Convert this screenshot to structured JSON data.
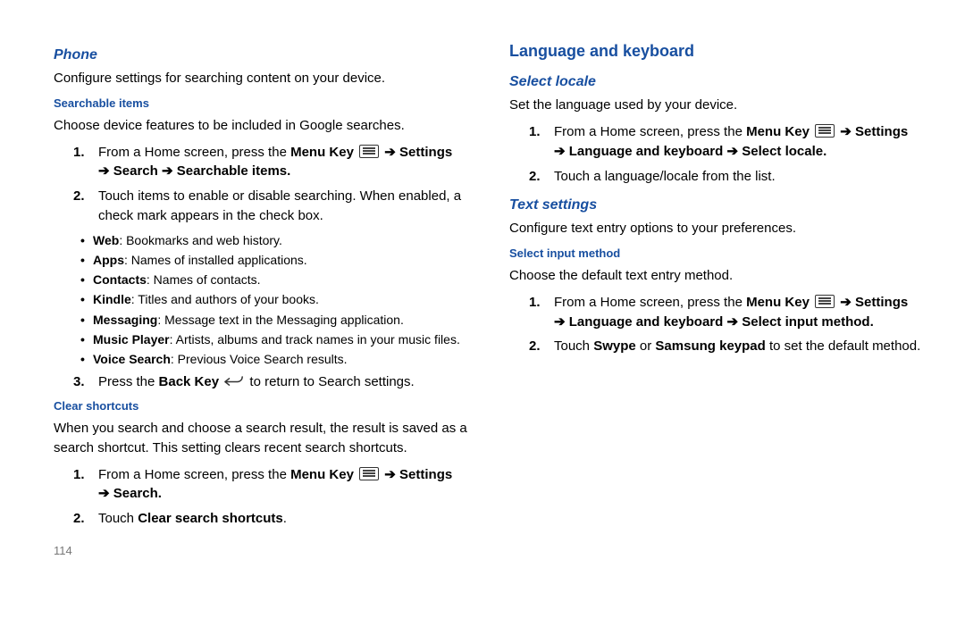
{
  "page_number": "114",
  "left": {
    "phone_heading": "Phone",
    "phone_body": "Configure settings for searching content on your device.",
    "searchable_heading": "Searchable items",
    "searchable_body": "Choose device features to be included in Google searches.",
    "si_step1_prefix": "From a Home screen, press the ",
    "menu_key": "Menu Key",
    "arrow": "➔",
    "settings": "Settings",
    "search": "Search",
    "searchable_items_label": "Searchable items",
    "si_step2": "Touch items to enable or disable searching. When enabled, a check mark appears in the check box.",
    "bullets": {
      "web_b": "Web",
      "web_t": ": Bookmarks and web history.",
      "apps_b": "Apps",
      "apps_t": ": Names of installed applications.",
      "contacts_b": "Contacts",
      "contacts_t": ": Names of contacts.",
      "kindle_b": "Kindle",
      "kindle_t": ": Titles and authors of your books.",
      "msg_b": "Messaging",
      "msg_t": ":  Message text in the Messaging application.",
      "music_b": "Music Player",
      "music_t": ": Artists, albums and track names in your music files.",
      "voice_b": "Voice Search",
      "voice_t": ": Previous Voice Search results."
    },
    "si_step3_prefix": "Press the ",
    "back_key": "Back Key",
    "si_step3_suffix": " to return to Search settings.",
    "clear_heading": "Clear shortcuts",
    "clear_body": "When you search and choose a search result, the result is saved as a search shortcut. This setting clears recent search shortcuts.",
    "cs_step2_prefix": "Touch ",
    "cs_step2_bold": "Clear search shortcuts",
    "period": "."
  },
  "right": {
    "lang_heading": "Language and keyboard",
    "select_locale_heading": "Select locale",
    "select_locale_body": "Set the language used by your device.",
    "lang_keyboard": "Language and keyboard",
    "select_locale_label": "Select locale",
    "sl_step2": "Touch a language/locale from the list.",
    "text_settings_heading": "Text settings",
    "text_settings_body": "Configure text entry options to your preferences.",
    "select_input_heading": "Select input method",
    "select_input_body": "Choose the default text entry method.",
    "select_input_label": "Select input method",
    "sim_step2_prefix": "Touch ",
    "swype": "Swype",
    "or": " or ",
    "samsung_kp": "Samsung keypad",
    "sim_step2_suffix": " to set the default method."
  }
}
